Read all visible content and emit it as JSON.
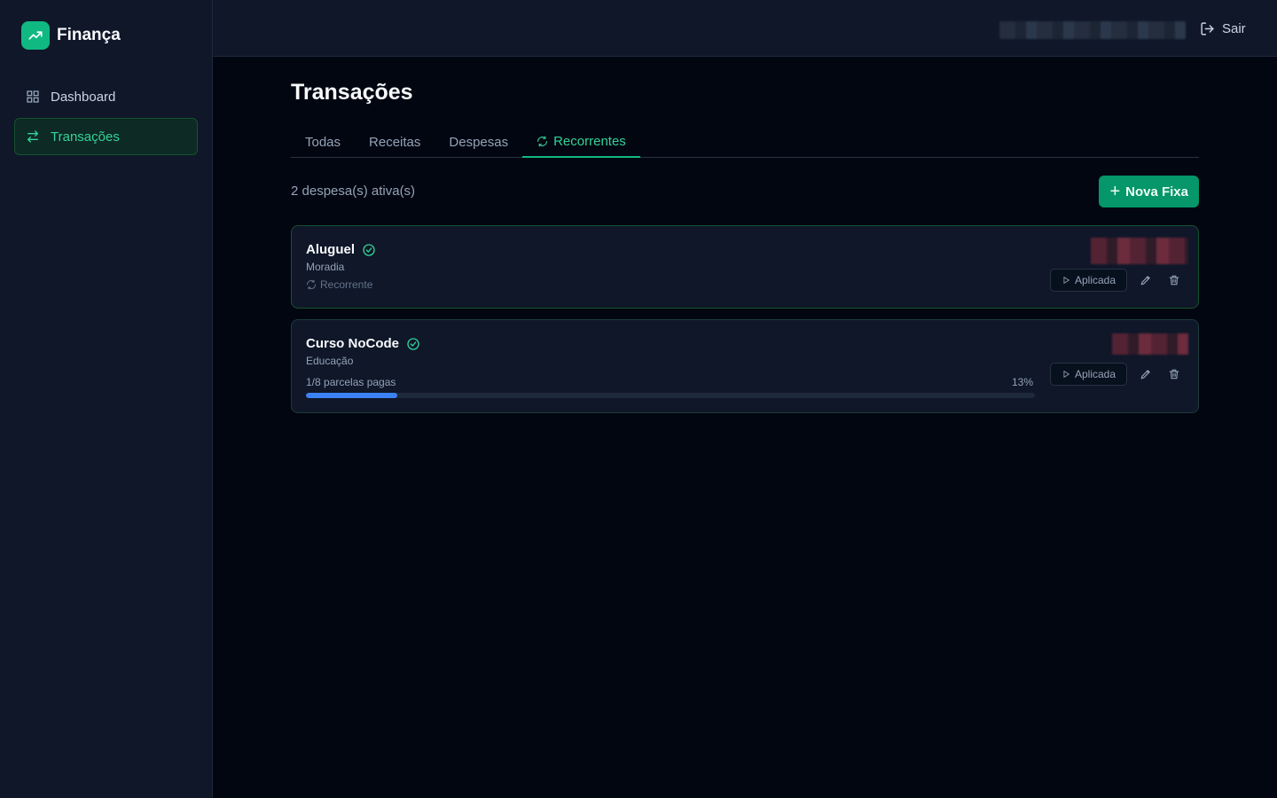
{
  "brand": {
    "name": "Finança"
  },
  "sidebar": {
    "items": [
      {
        "label": "Dashboard",
        "icon": "dashboard-icon",
        "active": false
      },
      {
        "label": "Transações",
        "icon": "transfer-icon",
        "active": true
      }
    ]
  },
  "header": {
    "logout_label": "Sair"
  },
  "page": {
    "title": "Transações"
  },
  "tabs": [
    {
      "label": "Todas",
      "active": false
    },
    {
      "label": "Receitas",
      "active": false
    },
    {
      "label": "Despesas",
      "active": false
    },
    {
      "label": "Recorrentes",
      "active": true,
      "icon": "repeat-icon"
    }
  ],
  "summary": {
    "count_text": "2 despesa(s) ativa(s)"
  },
  "actions": {
    "new_fixed_label": "Nova Fixa"
  },
  "transactions": [
    {
      "title": "Aluguel",
      "category": "Moradia",
      "recurrence_label": "Recorrente",
      "apply_label": "Aplicada"
    },
    {
      "title": "Curso NoCode",
      "category": "Educação",
      "progress_label": "1/8 parcelas pagas",
      "progress_percent": "13%",
      "progress_fraction": 0.125,
      "apply_label": "Aplicada"
    }
  ],
  "colors": {
    "accent": "#10b981",
    "progress": "#3b82f6",
    "background": "#020611",
    "sidebar": "#0f1729"
  }
}
